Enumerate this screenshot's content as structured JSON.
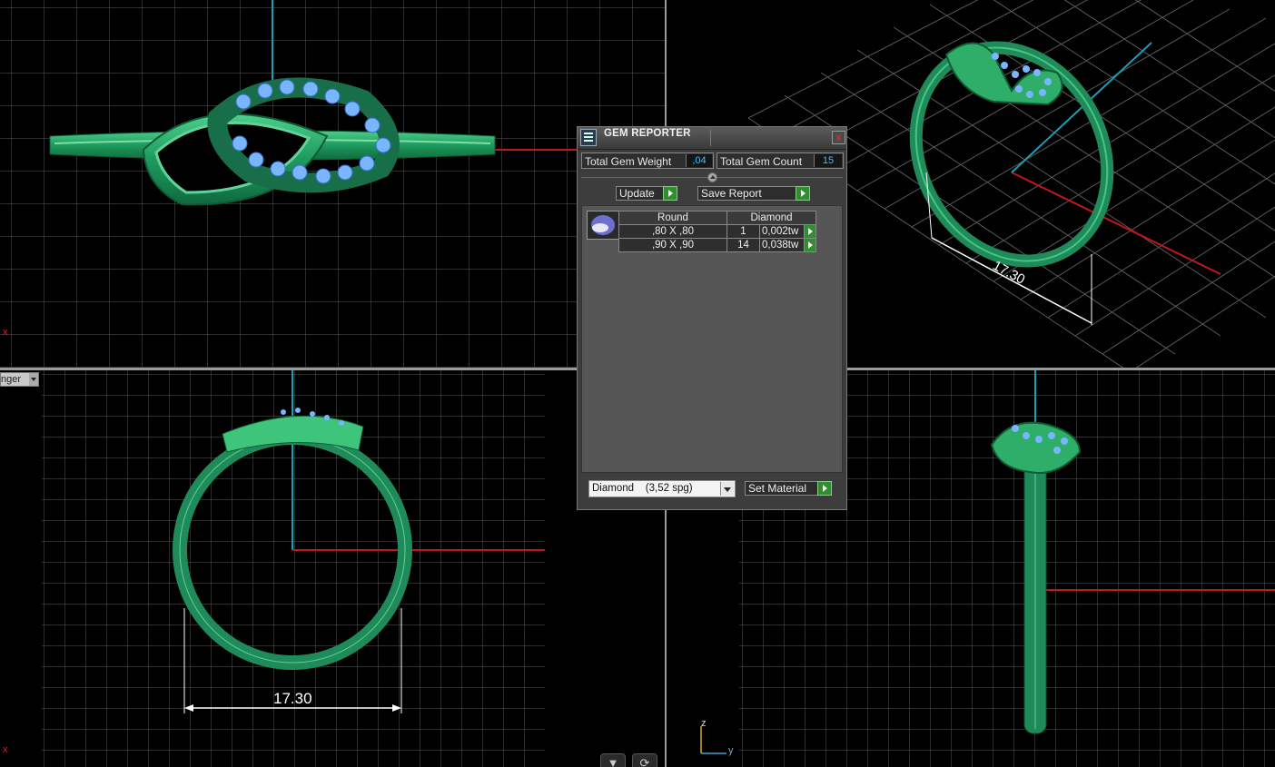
{
  "dialog": {
    "title": "GEM REPORTER",
    "close_label": "x",
    "total_weight_label": "Total Gem Weight",
    "total_weight_value": ",04",
    "total_count_label": "Total Gem Count",
    "total_count_value": "15",
    "update_label": "Update",
    "save_report_label": "Save Report",
    "table": {
      "shape": "Round",
      "material": "Diamond",
      "rows": [
        {
          "size": ",80 X ,80",
          "count": "1",
          "weight": "0,002tw"
        },
        {
          "size": ",90 X ,90",
          "count": "14",
          "weight": "0,038tw"
        }
      ]
    },
    "material_select": "Diamond    (3,52 spg)",
    "set_material_label": "Set Material"
  },
  "viewports": {
    "dimension_front": "17.30",
    "dimension_perspective": "17.30",
    "view_selector": "nger"
  },
  "axes": {
    "z": "z",
    "y": "y",
    "x": "x"
  },
  "colors": {
    "ring_green": "#1f8a5a",
    "gem_blue": "#7ab6ff",
    "axis_red": "#c01818",
    "axis_cyan": "#1a9fb8",
    "grid": "#5a5a5a"
  }
}
